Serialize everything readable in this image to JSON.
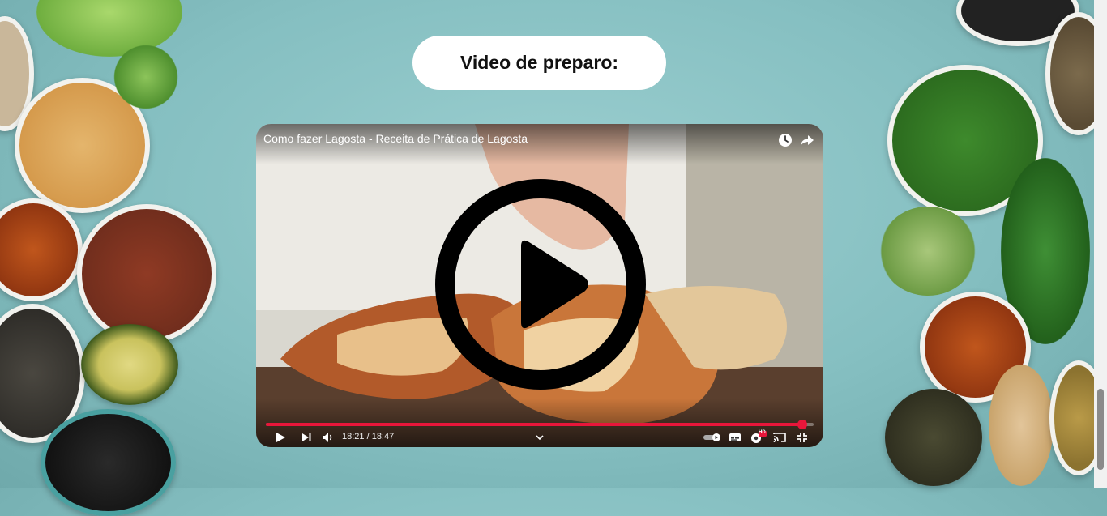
{
  "section": {
    "title": "Video de preparo:"
  },
  "video": {
    "title": "Como fazer Lagosta - Receita de Prática de Lagosta",
    "time_display": "18:21 / 18:47",
    "progress_fraction": 0.98,
    "accent_color": "#e8163a",
    "icons": {
      "watch_later": "clock-icon",
      "share": "share-icon",
      "play": "play-icon",
      "next": "next-icon",
      "volume": "volume-icon",
      "chapters": "chevron-down-icon",
      "autoplay": "autoplay-toggle-icon",
      "subtitles": "subtitles-icon",
      "settings": "settings-icon",
      "cast": "cast-icon",
      "exit_fullscreen": "exit-fullscreen-icon"
    },
    "settings_badge": "HD"
  }
}
